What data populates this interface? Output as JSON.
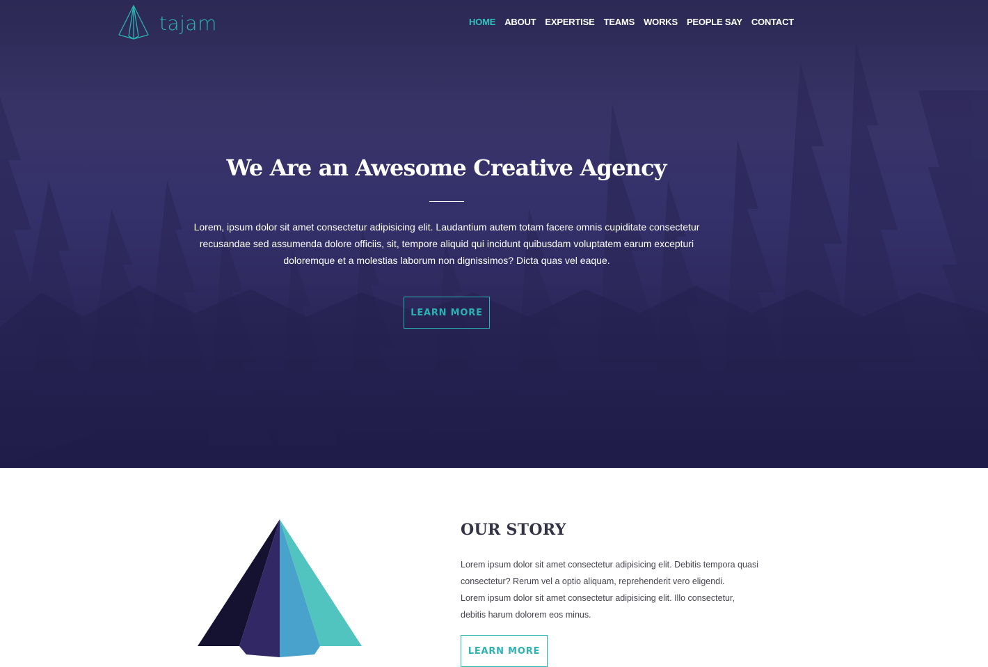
{
  "brand": {
    "name": "tajam",
    "accent_color": "#2bb3b1",
    "logo_icon": "pyramid-outline-icon"
  },
  "nav": {
    "items": [
      {
        "label": "HOME",
        "active": true
      },
      {
        "label": "ABOUT",
        "active": false
      },
      {
        "label": "EXPERTISE",
        "active": false
      },
      {
        "label": "TEAMS",
        "active": false
      },
      {
        "label": "WORKS",
        "active": false
      },
      {
        "label": "PEOPLE SAY",
        "active": false
      },
      {
        "label": "CONTACT",
        "active": false
      }
    ]
  },
  "hero": {
    "title": "We Are an Awesome Creative Agency",
    "text": "Lorem, ipsum dolor sit amet consectetur adipisicing elit. Laudantium autem totam facere omnis cupiditate consectetur recusandae sed assumenda dolore officiis, sit, tempore aliquid qui incidunt quibusdam voluptatem earum excepturi doloremque et a molestias laborum non dignissimos? Dicta quas vel eaque.",
    "button_label": "LEARN MORE",
    "background_color": "#322f5c"
  },
  "story": {
    "title": "OUR STORY",
    "lines": [
      "Lorem ipsum dolor sit amet consectetur adipisicing elit. Debitis tempora quasi",
      "consectetur? Rerum vel a optio aliquam, reprehenderit vero eligendi.",
      "Lorem ipsum dolor sit amet consectetur adipisicing elit. Illo consectetur,",
      "debitis harum dolorem eos minus."
    ],
    "button_label": "LEARN MORE",
    "art_icon": "pyramid-illustration",
    "art_colors": [
      "#141230",
      "#322865",
      "#48a2cc",
      "#52c4c0"
    ]
  }
}
